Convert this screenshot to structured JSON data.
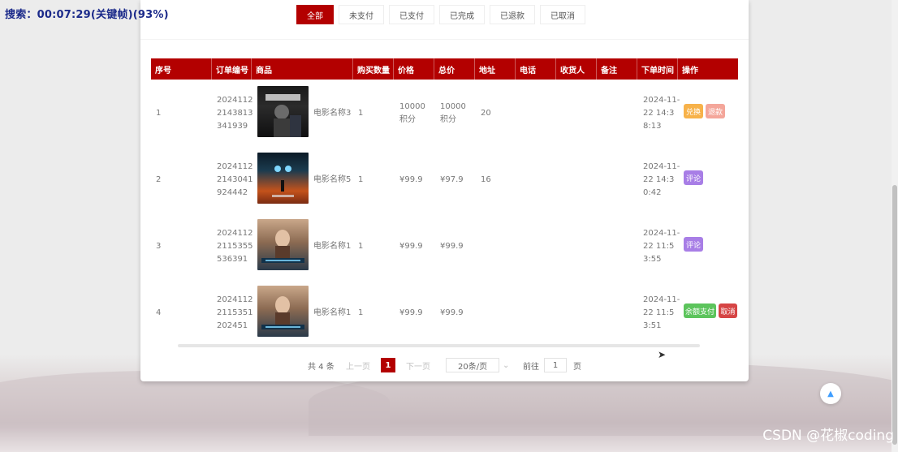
{
  "overlay": {
    "timer": "搜索：00:07:29(关键帧)(93%)"
  },
  "watermark": "CSDN @花椒coding",
  "tabs": [
    {
      "label": "全部",
      "active": true
    },
    {
      "label": "未支付"
    },
    {
      "label": "已支付"
    },
    {
      "label": "已完成"
    },
    {
      "label": "已退款"
    },
    {
      "label": "已取消"
    }
  ],
  "table": {
    "headers": [
      "序号",
      "订单编号",
      "商品",
      "购买数量",
      "价格",
      "总价",
      "地址",
      "电话",
      "收货人",
      "备注",
      "下单时间",
      "操作"
    ],
    "rows": [
      {
        "index": "1",
        "order_no": [
          "2024112",
          "2143813",
          "341939"
        ],
        "product": "电影名称3",
        "qty": "1",
        "price": [
          "10000",
          "积分"
        ],
        "total": [
          "10000",
          "积分"
        ],
        "address": "20",
        "phone": "",
        "receiver": "",
        "note": "",
        "time": [
          "2024-11-",
          "22 14:3",
          "8:13"
        ],
        "actions": [
          {
            "label": "兑换",
            "color": "#f7b24a"
          },
          {
            "label": "退款",
            "color": "#f4a69a"
          }
        ]
      },
      {
        "index": "2",
        "order_no": [
          "2024112",
          "2143041",
          "924442"
        ],
        "product": "电影名称5",
        "qty": "1",
        "price": [
          "¥99.9"
        ],
        "total": [
          "¥97.9"
        ],
        "address": "16",
        "phone": "",
        "receiver": "",
        "note": "",
        "time": [
          "2024-11-",
          "22 14:3",
          "0:42"
        ],
        "actions": [
          {
            "label": "评论",
            "color": "#a87ee6"
          }
        ]
      },
      {
        "index": "3",
        "order_no": [
          "2024112",
          "2115355",
          "536391"
        ],
        "product": "电影名称1",
        "qty": "1",
        "price": [
          "¥99.9"
        ],
        "total": [
          "¥99.9"
        ],
        "address": "",
        "phone": "",
        "receiver": "",
        "note": "",
        "time": [
          "2024-11-",
          "22 11:5",
          "3:55"
        ],
        "actions": [
          {
            "label": "评论",
            "color": "#a87ee6"
          }
        ]
      },
      {
        "index": "4",
        "order_no": [
          "2024112",
          "2115351",
          "202451"
        ],
        "product": "电影名称1",
        "qty": "1",
        "price": [
          "¥99.9"
        ],
        "total": [
          "¥99.9"
        ],
        "address": "",
        "phone": "",
        "receiver": "",
        "note": "",
        "time": [
          "2024-11-",
          "22 11:5",
          "3:51"
        ],
        "actions": [
          {
            "label": "余额支付",
            "color": "#5cc45c"
          },
          {
            "label": "取消",
            "color": "#d64545"
          }
        ]
      }
    ]
  },
  "pagination": {
    "total": "共 4 条",
    "prev": "上一页",
    "current": "1",
    "next": "下一页",
    "page_size": "20条/页",
    "goto_label": "前往",
    "goto_value": "1",
    "page_suffix": "页"
  },
  "colors": {
    "brand": "#b30000"
  },
  "icons": {
    "back_to_top": "caret-up-icon"
  }
}
